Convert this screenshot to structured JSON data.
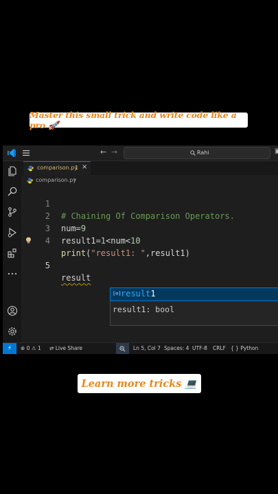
{
  "overlay": {
    "top_banner": "Master this small trick and write code like a pro 🚀",
    "bottom_banner": "Learn more tricks 💻"
  },
  "titlebar": {
    "search_text": "Rahi"
  },
  "tab": {
    "filename": "comparison.py",
    "modified_badge": "1",
    "close_glyph": "×"
  },
  "breadcrumb": {
    "filename": "comparison.py",
    "chevron": "›"
  },
  "editor": {
    "lines": [
      {
        "number": "1",
        "parts": [
          {
            "t": "# Chaining Of Comparison Operators.",
            "c": "comment"
          }
        ]
      },
      {
        "number": "2",
        "parts": [
          {
            "t": "num=",
            "c": "text"
          },
          {
            "t": "9",
            "c": "num"
          }
        ]
      },
      {
        "number": "3",
        "parts": [
          {
            "t": "result1=",
            "c": "text"
          },
          {
            "t": "1",
            "c": "num"
          },
          {
            "t": "<num<",
            "c": "text"
          },
          {
            "t": "10",
            "c": "num"
          }
        ]
      },
      {
        "number": "4",
        "parts": [
          {
            "t": "print",
            "c": "fn"
          },
          {
            "t": "(",
            "c": "text"
          },
          {
            "t": "\"result1: \"",
            "c": "str"
          },
          {
            "t": ",result1)",
            "c": "text"
          }
        ]
      },
      {
        "number": "5",
        "parts": [
          {
            "t": "result",
            "c": "text squig"
          }
        ]
      }
    ]
  },
  "suggest": {
    "item_icon": "[⊙]",
    "item_match": "result",
    "item_rest": "1",
    "detail": "result1: bool",
    "close_glyph": "×"
  },
  "statusbar": {
    "remote_glyph": "⚡",
    "errors": "0",
    "warnings": "1",
    "liveshare": "Live Share",
    "position": "Ln 5, Col 7",
    "spaces": "Spaces: 4",
    "encoding": "UTF-8",
    "eol": "CRLF",
    "lang_glyph": "{ }",
    "language": "Python"
  },
  "colors": {
    "accent": "#0078d4",
    "banner_text": "#e8871e",
    "editor_bg": "#1e1e1e"
  },
  "icons": [
    "vscode-logo-icon",
    "menu-icon",
    "explorer-icon",
    "search-icon",
    "source-control-icon",
    "run-debug-icon",
    "extensions-icon",
    "more-icon",
    "account-icon",
    "settings-gear-icon",
    "lightbulb-icon",
    "python-file-icon",
    "variable-icon",
    "zoom-icon"
  ]
}
